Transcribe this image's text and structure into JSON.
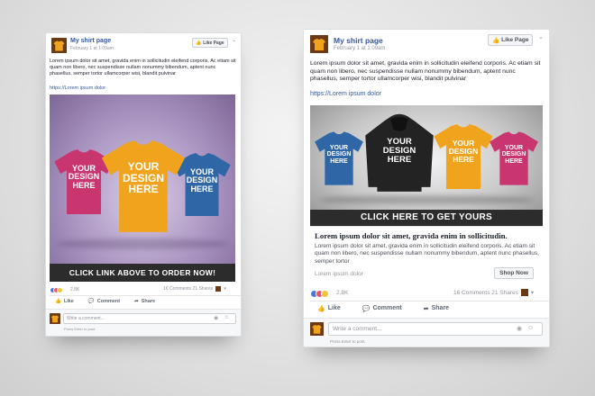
{
  "post_left": {
    "page_name": "My shirt page",
    "date": "February 1 at 1:09am",
    "like_page_label": "Like Page",
    "text": "Lorem ipsum dolor sit amet, gravida enim in sollicitudin eleifend corporis. Ac etiam sit quam non libero, nec suspendisse nullam nonummy bibendum, aptent nunc phasellus, semper tortor ullamcorper wisi, blandit pulvinar",
    "link": "https://Lorem ipsum dolor",
    "shirt_labels": [
      "YOUR DESIGN HERE",
      "YOUR DESIGN HERE",
      "YOUR DESIGN HERE"
    ],
    "cta": "CLICK LINK ABOVE TO ORDER NOW!",
    "reaction_count": "2.8K",
    "comments_shares": "16 Comments  21 Shares",
    "actions": [
      "Like",
      "Comment",
      "Share"
    ],
    "comment_placeholder": "Write a comment...",
    "press_enter": "Press Enter to post."
  },
  "post_right": {
    "page_name": "My shirt page",
    "date": "February 1 at 1:09am",
    "like_page_label": "Like Page",
    "text": "Lorem ipsum dolor sit amet, gravida enim in sollicitudin eleifend corporis. Ac etiam sit quam non libero, nec suspendisse nullam nonummy bibendum, aptent nunc phasellus, semper tortor ullamcorper wisi, blandit pulvinar",
    "link": "https://Lorem ipsum dolor",
    "shirt_labels": [
      "YOUR DESIGN HERE",
      "YOUR DESIGN HERE",
      "YOUR DESIGN HERE",
      "YOUR DESIGN HERE"
    ],
    "cta": "CLICK  HERE TO GET YOURS",
    "card_title": "Lorem ipsum dolor sit amet, gravida enim in sollicitudin.",
    "card_text": "Lorem ipsum dolor sit amet, gravida enim in sollicitudin eleifend corporis. Ac etiam sit quam non libero, nec suspendisse nullam nonummy bibendum, aptent nunc phasellus, semper tortor",
    "card_domain": "Lorem ipsum dolor",
    "shop_now": "Shop Now",
    "reaction_count": "2.8K",
    "comments_shares": "16 Comments  21 Shares",
    "actions": [
      "Like",
      "Comment",
      "Share"
    ],
    "comment_placeholder": "Write a comment...",
    "press_enter": "Press Enter to post."
  },
  "colors": {
    "link_blue": "#365899",
    "pink": "#c8356f",
    "yellow": "#f0a41d",
    "blue": "#2f67a6",
    "black": "#232323",
    "cta_bg": "#2c2c2c"
  },
  "icons": [
    "shirt-avatar-icon",
    "thumbs-up-icon",
    "comment-icon",
    "share-icon",
    "camera-icon",
    "emoji-icon",
    "chevron-down-icon"
  ]
}
